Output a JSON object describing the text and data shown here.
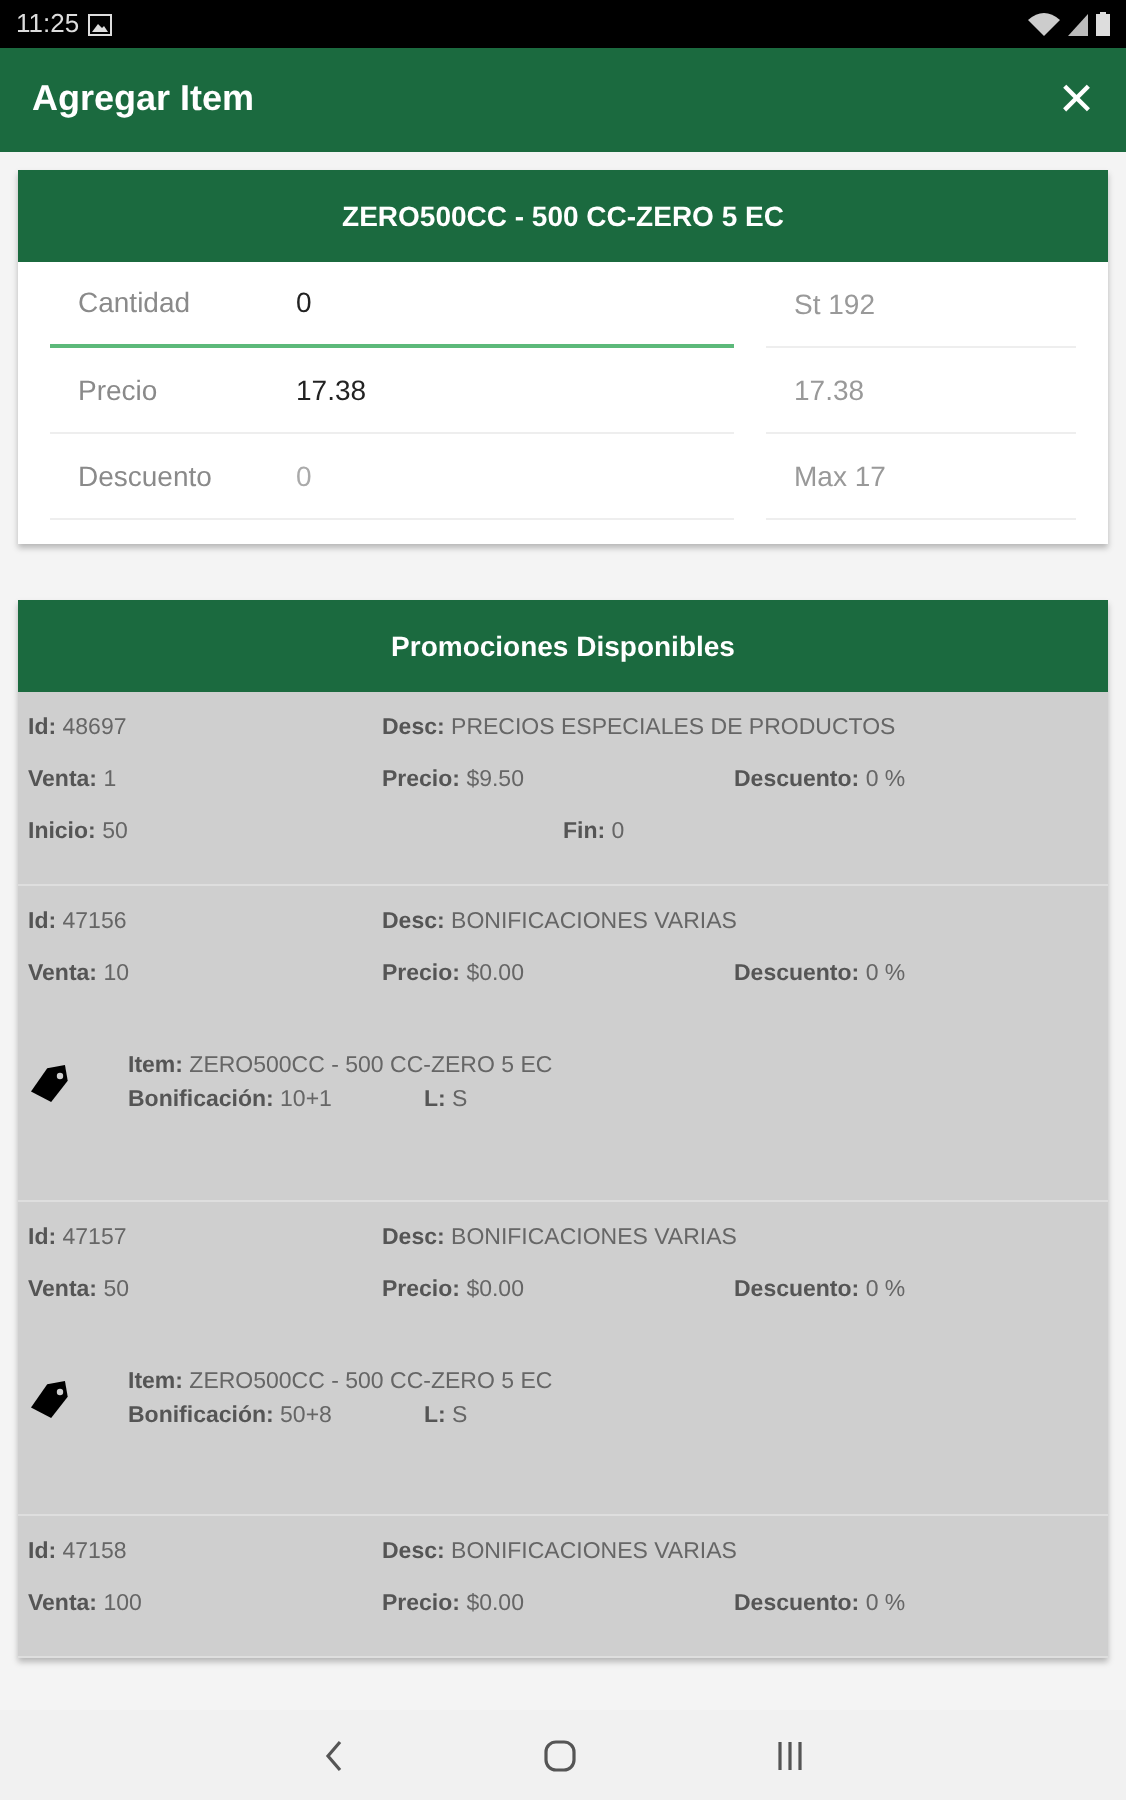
{
  "status_bar": {
    "time": "11:25"
  },
  "app_bar": {
    "title": "Agregar Item",
    "close": "×"
  },
  "product": {
    "title": "ZERO500CC - 500 CC-ZERO 5 EC",
    "fields": [
      {
        "label": "Cantidad",
        "value": "0",
        "focused": true,
        "side": "St 192"
      },
      {
        "label": "Precio",
        "value": "17.38",
        "focused": false,
        "side": "17.38"
      },
      {
        "label": "Descuento",
        "placeholder": "0",
        "focused": false,
        "side": "Max 17"
      }
    ]
  },
  "promotions": {
    "title": "Promociones Disponibles",
    "items": [
      {
        "id": "**Id:** 48697",
        "desc": "**Desc:** PRECIOS ESPECIALES DE PRODUCTOS",
        "venta": "**Venta:** 1",
        "precio": "**Precio:** $9.50",
        "descuento": "**Descuento:** 0 %",
        "inicio": "**Inicio:** 50",
        "fin": "**Fin:** 0"
      },
      {
        "id": "**Id:** 47156",
        "desc": "**Desc:** BONIFICACIONES VARIAS",
        "venta": "**Venta:** 10",
        "precio": "**Precio:** $0.00",
        "descuento": "**Descuento:** 0 %",
        "bonus": {
          "item": "**Item:** ZERO500CC - 500 CC-ZERO 5 EC",
          "bonificacion": "**Bonificación:** 10+1",
          "l": "**L:** S"
        }
      },
      {
        "id": "**Id:** 47157",
        "desc": "**Desc:** BONIFICACIONES VARIAS",
        "venta": "**Venta:** 50",
        "precio": "**Precio:** $0.00",
        "descuento": "**Descuento:** 0 %",
        "bonus": {
          "item": "**Item:** ZERO500CC - 500 CC-ZERO 5 EC",
          "bonificacion": "**Bonificación:** 50+8",
          "l": "**L:** S"
        }
      },
      {
        "id": "**Id:** 47158",
        "desc": "**Desc:** BONIFICACIONES VARIAS",
        "venta": "**Venta:** 100",
        "precio": "**Precio:** $0.00",
        "descuento": "**Descuento:** 0 %"
      }
    ]
  }
}
